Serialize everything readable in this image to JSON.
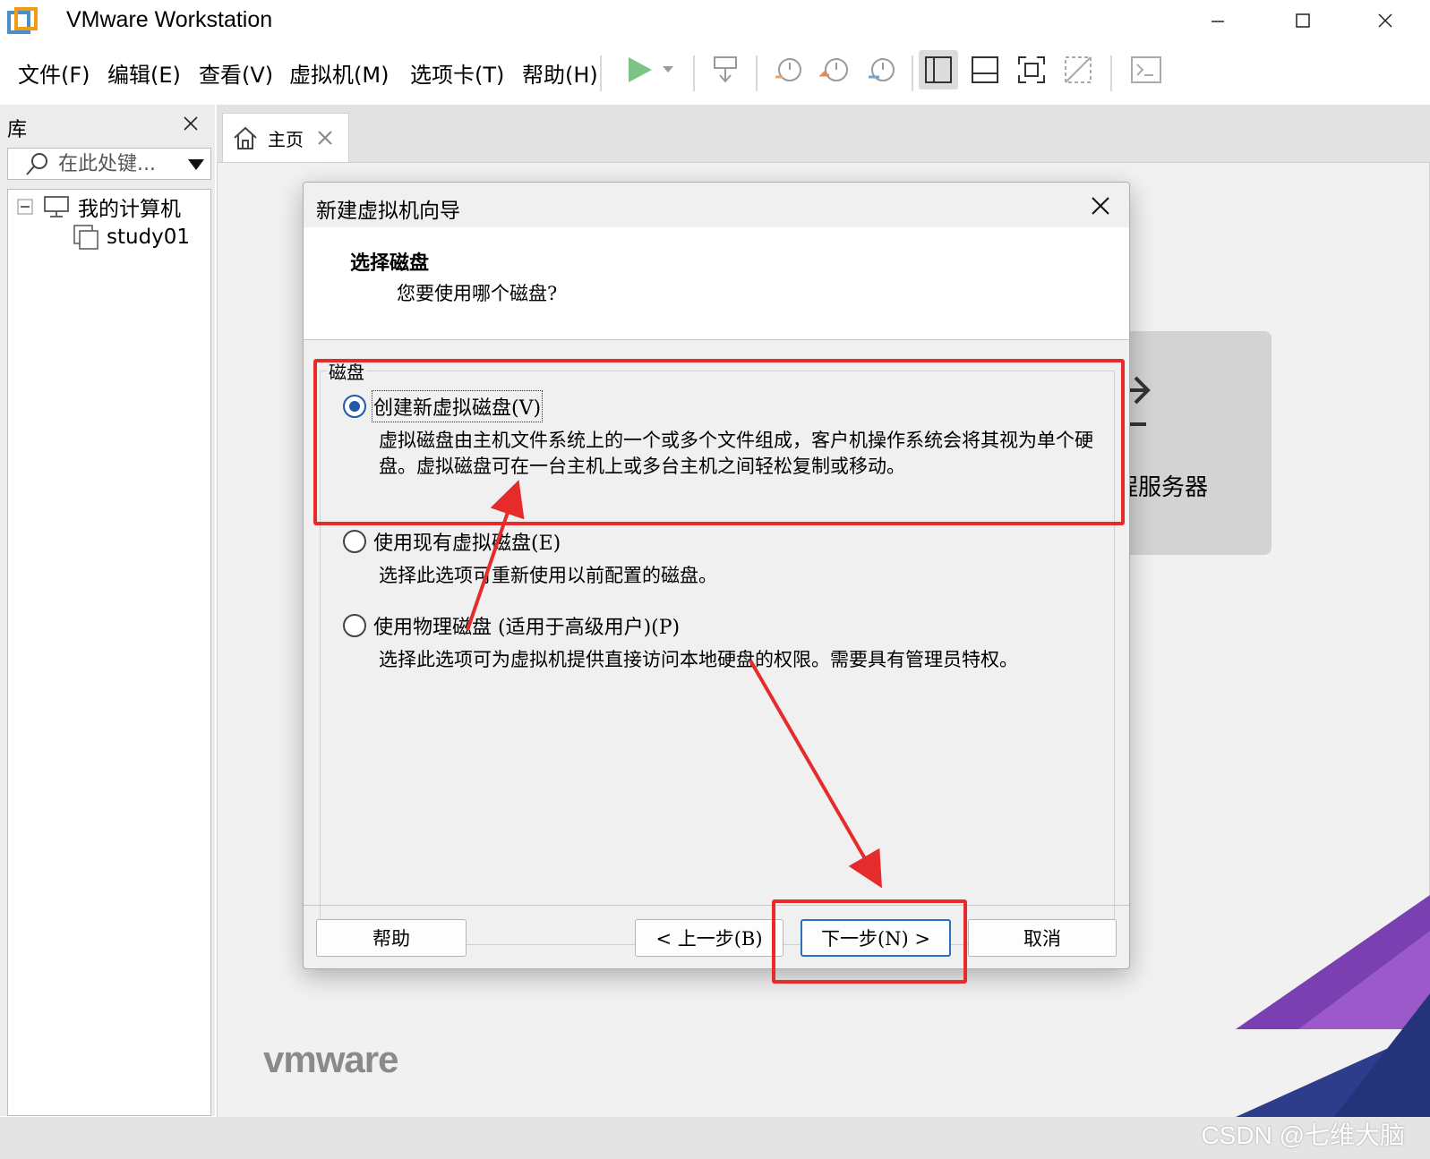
{
  "window": {
    "title": "VMware Workstation"
  },
  "menu": [
    "文件(F)",
    "编辑(E)",
    "查看(V)",
    "虚拟机(M)",
    "选项卡(T)",
    "帮助(H)"
  ],
  "library": {
    "title": "库",
    "search_placeholder": "在此处键...",
    "tree": {
      "root_label": "我的计算机",
      "child_label": "study01"
    }
  },
  "tabs": [
    {
      "label": "主页"
    }
  ],
  "home": {
    "remote_server_label": "程服务器",
    "brand_logo": "vmware"
  },
  "dialog": {
    "title": "新建虚拟机向导",
    "header_title": "选择磁盘",
    "header_subtitle": "您要使用哪个磁盘?",
    "group_label": "磁盘",
    "options": [
      {
        "label": "创建新虚拟磁盘(V)",
        "selected": true,
        "description": "虚拟磁盘由主机文件系统上的一个或多个文件组成，客户机操作系统会将其视为单个硬盘。虚拟磁盘可在一台主机上或多台主机之间轻松复制或移动。"
      },
      {
        "label": "使用现有虚拟磁盘(E)",
        "selected": false,
        "description": "选择此选项可重新使用以前配置的磁盘。"
      },
      {
        "label": "使用物理磁盘 (适用于高级用户)(P)",
        "selected": false,
        "description": "选择此选项可为虚拟机提供直接访问本地硬盘的权限。需要具有管理员特权。"
      }
    ],
    "buttons": {
      "help": "帮助",
      "back": "< 上一步(B)",
      "next": "下一步(N) >",
      "cancel": "取消"
    }
  },
  "watermark": "CSDN @七维大脑",
  "colors": {
    "annotation": "#e52b2b",
    "radio_selected": "#1e5aa8",
    "play_green": "#4caf50"
  }
}
